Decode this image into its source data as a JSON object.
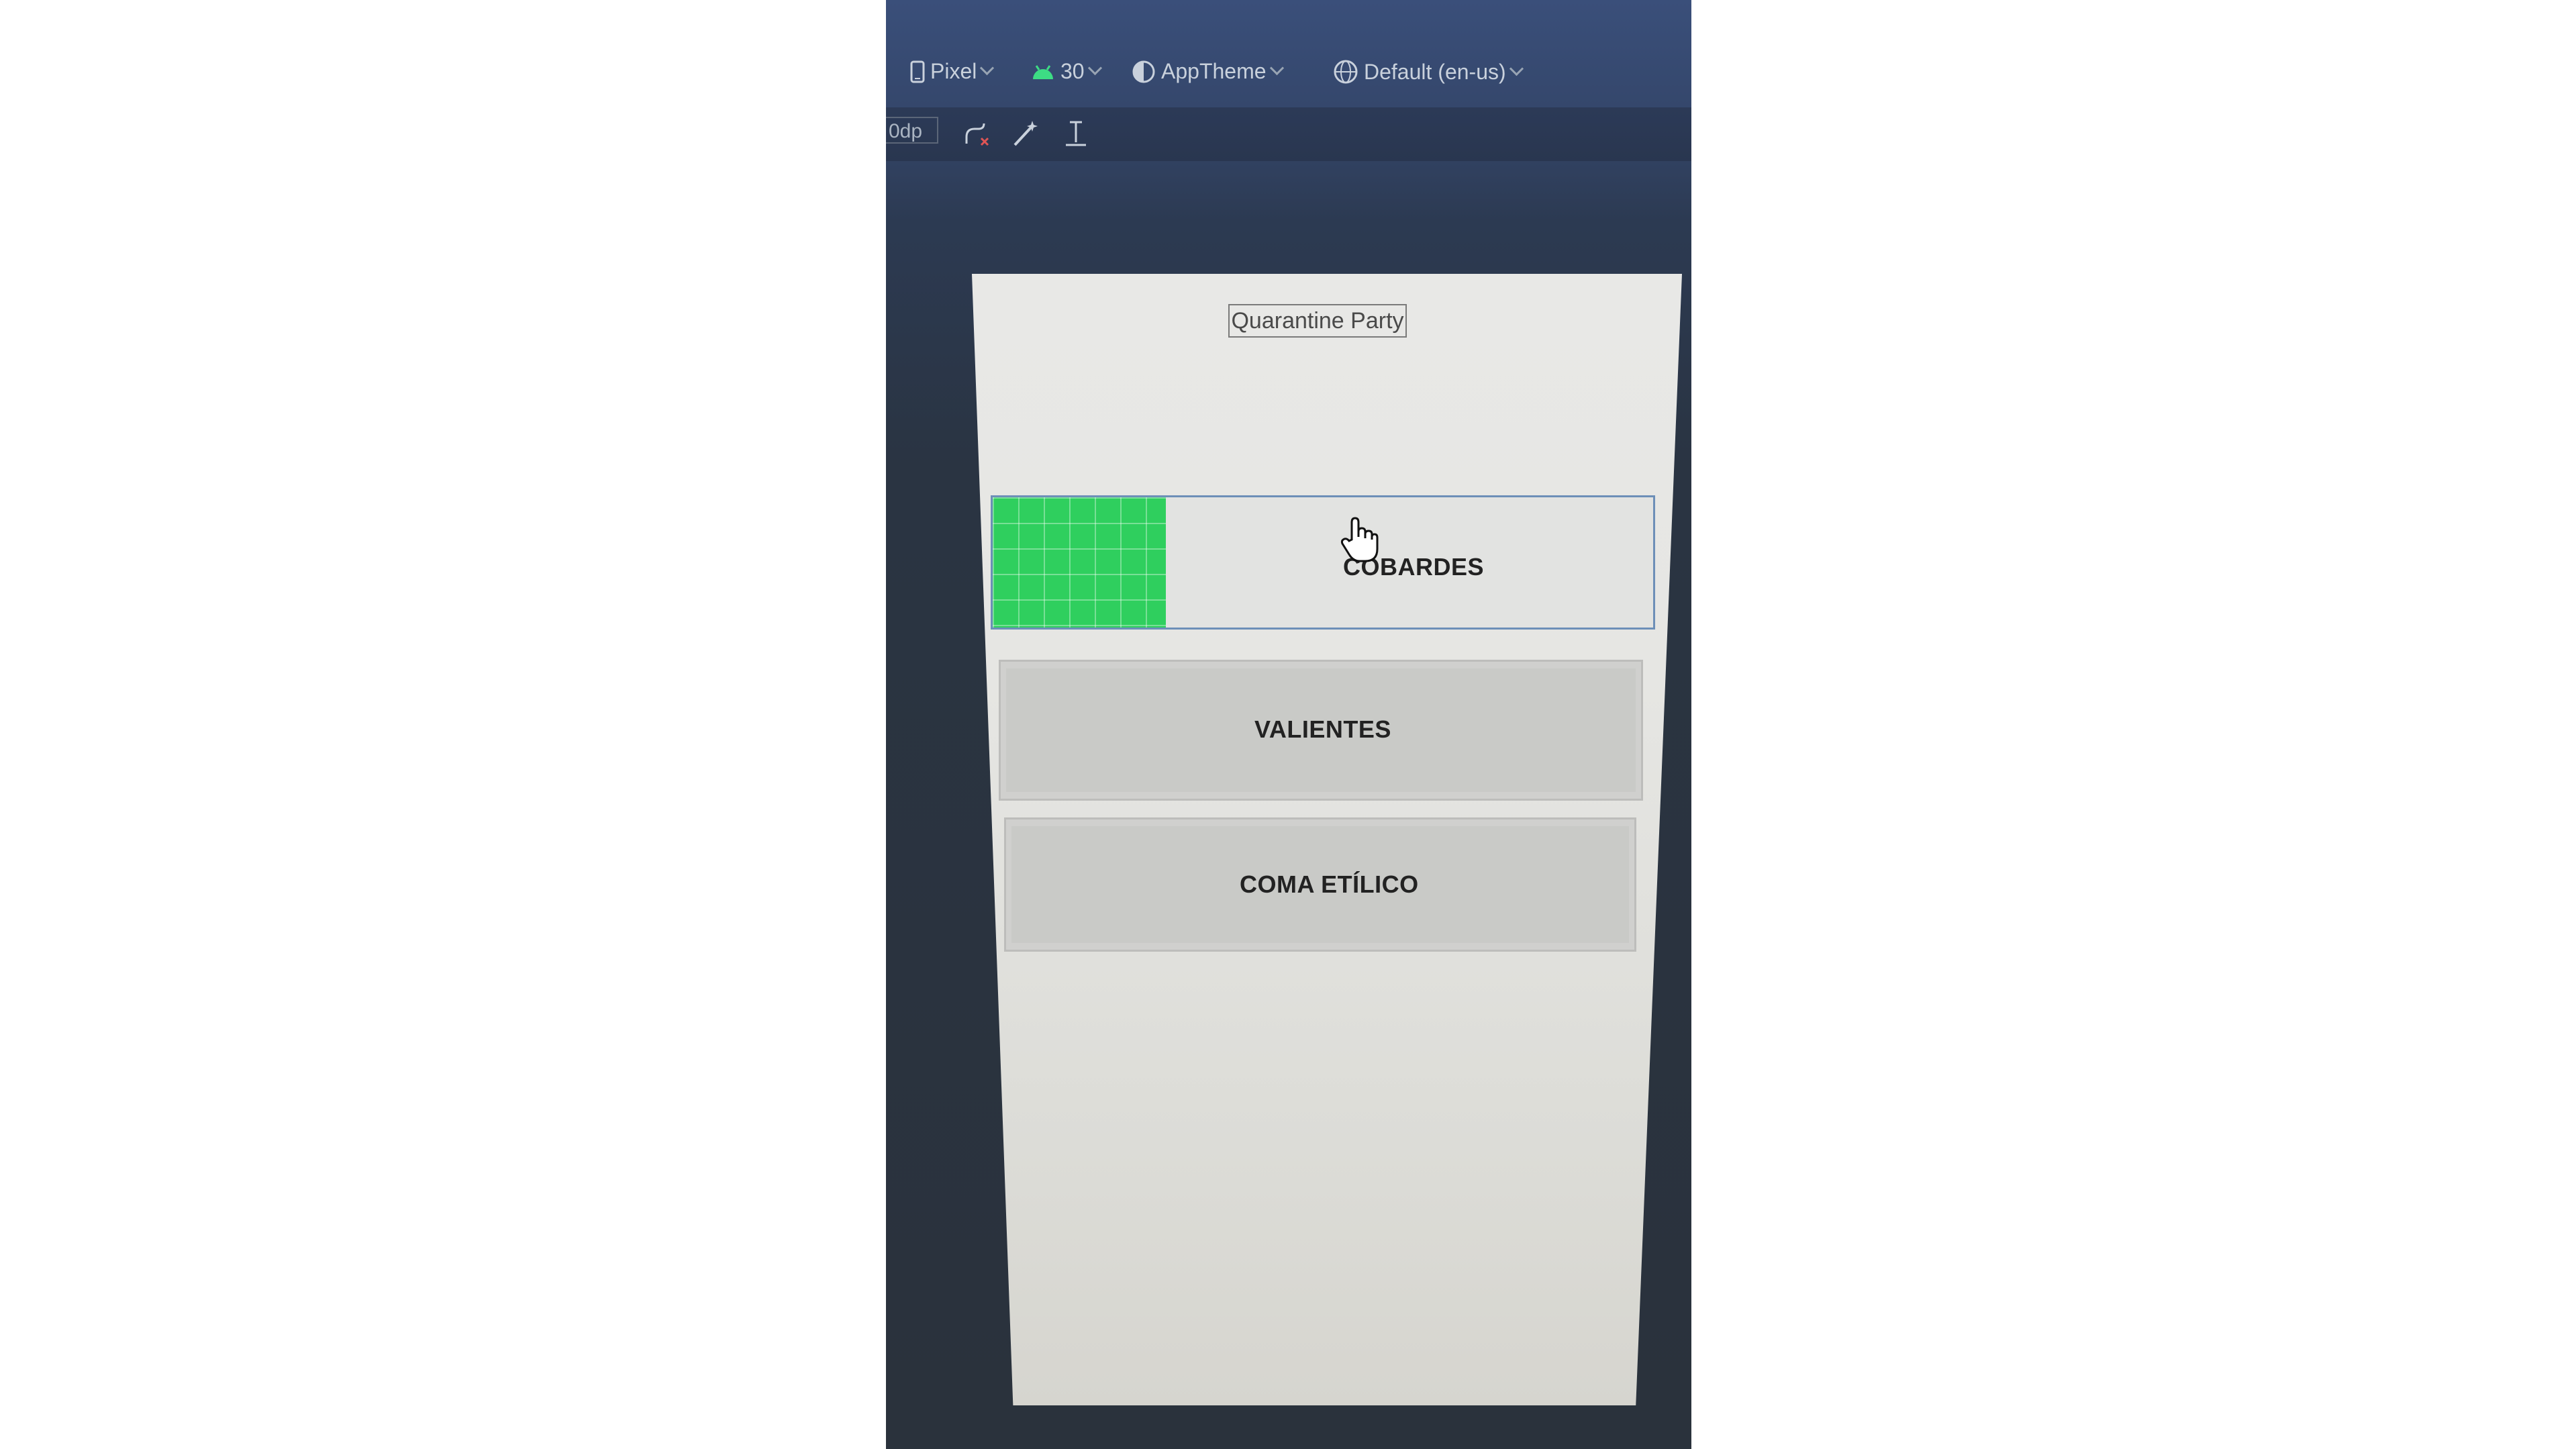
{
  "toolbar": {
    "device_label": "Pixel",
    "api_label": "30",
    "theme_label": "AppTheme",
    "locale_label": "Default (en-us)",
    "dp_value": "0dp"
  },
  "preview": {
    "title": "Quarantine Party",
    "buttons": [
      {
        "label": "COBARDES"
      },
      {
        "label": "VALIENTES"
      },
      {
        "label": "COMA ETÍLICO"
      }
    ]
  },
  "colors": {
    "ide_background": "#2a323c",
    "toolbar_background": "#3a4f7a",
    "selection_border": "#6d8fb8",
    "constraint_block": "#2fcf5e",
    "button_fill": "#c9cac7"
  },
  "icons": {
    "device": "phone-icon",
    "api": "android-icon",
    "theme": "theme-icon",
    "locale": "globe-icon",
    "clear_constraints": "clear-constraints-icon",
    "infer_constraints": "magic-wand-icon",
    "baseline": "baseline-icon",
    "cursor": "hand-pointer-icon"
  }
}
